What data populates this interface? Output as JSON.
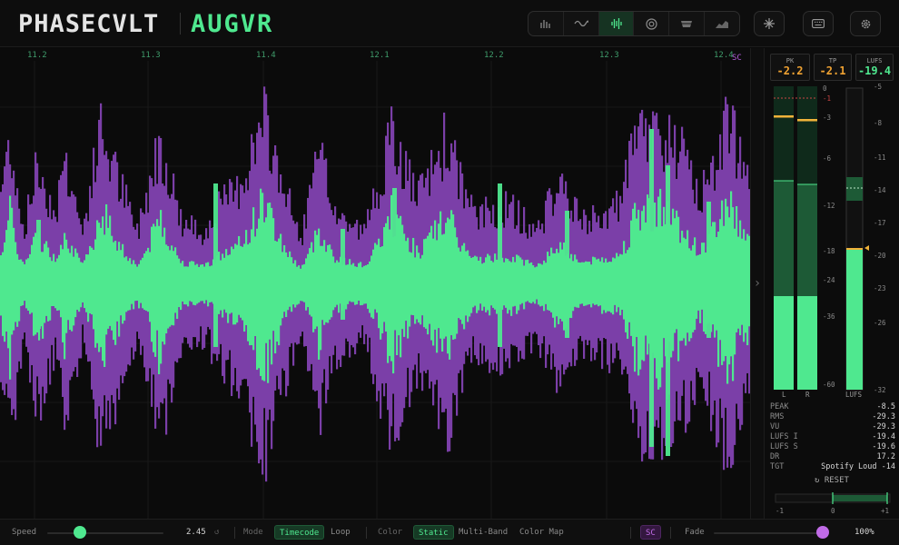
{
  "header": {
    "brand": "PHASECVLT",
    "product": "AUGVR",
    "view_buttons": [
      "bars-icon",
      "wave-icon",
      "waveform-icon",
      "target-icon",
      "bowl-icon",
      "chart-icon"
    ],
    "active_view": "waveform-icon",
    "tool_buttons": [
      "sparkle-icon",
      "keyboard-icon",
      "gear-icon"
    ]
  },
  "waveform": {
    "timecodes": [
      "11.2",
      "11.3",
      "11.4",
      "12.1",
      "12.2",
      "12.3",
      "12.4"
    ],
    "sc_flag": "SC",
    "colors": {
      "sidechain": "#7b3fa8",
      "main": "#4fe88f",
      "grid": "#1b1b1b"
    }
  },
  "meters": {
    "readouts": [
      {
        "label": "PK",
        "value": "-2.2",
        "color": "#f0a232"
      },
      {
        "label": "TP",
        "value": "-2.1",
        "color": "#f0a232"
      },
      {
        "label": "LUFS",
        "value": "-19.4",
        "color": "#4fe88f"
      }
    ],
    "peak_scale": [
      "0",
      "-1",
      "-3",
      "-6",
      "-12",
      "-18",
      "-24",
      "-36",
      "-60"
    ],
    "lufs_scale": [
      "-5",
      "-8",
      "-11",
      "-14",
      "-17",
      "-20",
      "-23",
      "-26",
      "-32"
    ],
    "bar_labels": [
      "L",
      "R",
      "LUFS"
    ],
    "stats": [
      {
        "label": "PEAK",
        "value": "-8.5"
      },
      {
        "label": "RMS",
        "value": "-29.3"
      },
      {
        "label": "VU",
        "value": "-29.3"
      },
      {
        "label": "LUFS I",
        "value": "-19.4"
      },
      {
        "label": "LUFS S",
        "value": "-19.6"
      },
      {
        "label": "DR",
        "value": "17.2"
      },
      {
        "label": "TGT",
        "value": "Spotify Loud -14"
      }
    ],
    "reset_label": "RESET",
    "balance_scale": [
      "-1",
      "0",
      "+1"
    ]
  },
  "controls": {
    "speed_label": "Speed",
    "speed_value": "2.45",
    "speed_fraction": 0.28,
    "mode_label": "Mode",
    "mode_options": [
      "Timecode",
      "Loop"
    ],
    "mode_selected": "Timecode",
    "color_label": "Color",
    "color_options": [
      "Static",
      "Multi-Band",
      "Color Map"
    ],
    "color_selected": "Static",
    "sc_label": "SC",
    "fade_label": "Fade",
    "fade_value": "100%",
    "fade_fraction": 1.0
  }
}
